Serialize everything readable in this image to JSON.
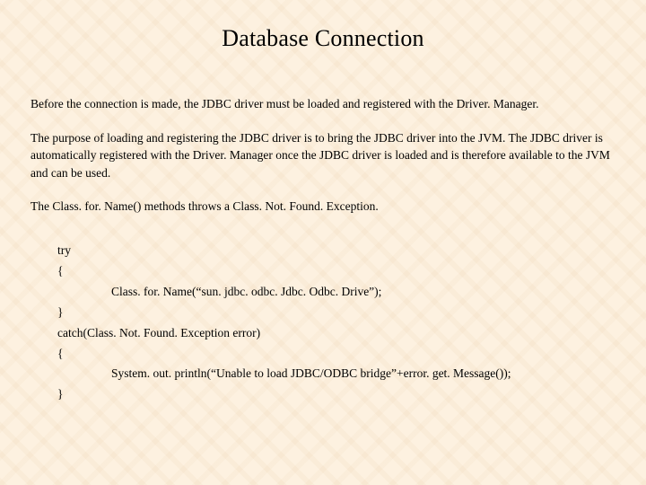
{
  "title": "Database Connection",
  "para1": "Before  the connection is made, the JDBC driver must be loaded and registered with the Driver. Manager.",
  "para2": "The purpose of loading and registering the JDBC driver is to bring the JDBC driver into the JVM. The JDBC driver is automatically registered with the Driver. Manager once the  JDBC driver is loaded and is therefore available to the JVM and can be used.",
  "para3": "The Class. for. Name() methods throws a Class. Not. Found. Exception.",
  "code": {
    "l1": "try",
    "l2": "{",
    "l3": "Class. for. Name(“sun. jdbc. odbc. Jdbc. Odbc. Drive”);",
    "l4": "}",
    "l5": "catch(Class. Not. Found. Exception error)",
    "l6": "{",
    "l7": "System. out. println(“Unable to load JDBC/ODBC bridge”+error. get. Message());",
    "l8": "}"
  }
}
